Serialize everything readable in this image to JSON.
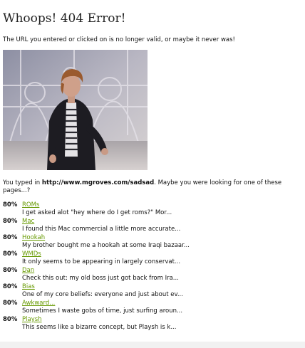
{
  "page": {
    "title": "Whoops! 404 Error!",
    "intro": "The URL you entered or clicked on is no longer valid, or maybe it never was!",
    "typed_prefix": "You typed in ",
    "typed_url": "http://www.mgroves.com/sadsad",
    "typed_suffix": ". Maybe you were looking for one of these pages...?"
  },
  "results": [
    {
      "score": "80%",
      "link": "ROMs",
      "snippet": "I get asked alot \"hey where do I get roms?\" Mor..."
    },
    {
      "score": "80%",
      "link": "Mac",
      "snippet": "I found this Mac commercial a little more accurate..."
    },
    {
      "score": "80%",
      "link": "Hookah",
      "snippet": "My brother bought me a hookah at some Iraqi bazaar..."
    },
    {
      "score": "80%",
      "link": "WMDs",
      "snippet": "It only seems to be appearing in largely conservat..."
    },
    {
      "score": "80%",
      "link": "Dan",
      "snippet": "Check this out: my old boss just got back from Ira..."
    },
    {
      "score": "80%",
      "link": "Bias",
      "snippet": "One of my core beliefs: everyone and just about ev..."
    },
    {
      "score": "80%",
      "link": "Awkward...",
      "snippet": "Sometimes I waste gobs of time, just surfing aroun..."
    },
    {
      "score": "80%",
      "link": "Playsh",
      "snippet": "This seems like a bizarre concept, but Playsh is k..."
    }
  ],
  "colors": {
    "link": "#669900",
    "text": "#111111"
  }
}
